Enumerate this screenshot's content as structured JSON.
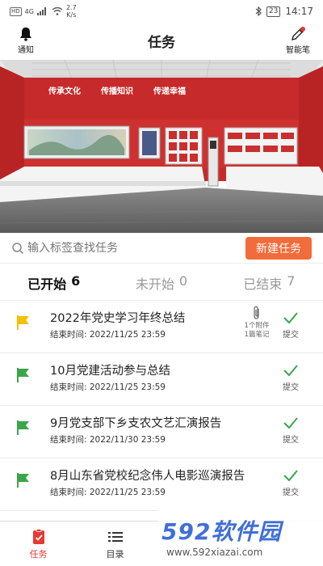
{
  "statusbar": {
    "hd": "HD",
    "signal": "4G",
    "speed_value": "2.7",
    "speed_unit": "K/s",
    "battery": "23",
    "time": "14:17"
  },
  "header": {
    "title": "任务",
    "notify_label": "通知",
    "smartpen_label": "智能笔"
  },
  "search": {
    "placeholder": "输入标签查找任务",
    "new_task_label": "新建任务"
  },
  "tabs": [
    {
      "label": "已开始",
      "count": "6"
    },
    {
      "label": "未开始",
      "count": "0"
    },
    {
      "label": "已结束",
      "count": "7"
    }
  ],
  "tasks": [
    {
      "title": "2022年党史学习年终总结",
      "due": "结束时间: 2022/11/25 23:59",
      "flag_color": "#f5c000",
      "attachments": "1个附件",
      "notes": "1篇笔记",
      "submit_label": "提交"
    },
    {
      "title": "10月党建活动参与总结",
      "due": "结束时间: 2022/11/25 23:59",
      "flag_color": "#3aa64a",
      "submit_label": "提交"
    },
    {
      "title": "9月党支部下乡支农文艺汇演报告",
      "due": "结束时间: 2022/11/30 23:59",
      "flag_color": "#3aa64a",
      "submit_label": "提交"
    },
    {
      "title": "8月山东省党校纪念伟人电影巡演报告",
      "due": "结束时间: 2022/11/25 23:59",
      "flag_color": "#3aa64a",
      "submit_label": "提交"
    }
  ],
  "banner": {
    "wall_text": [
      "传承文化",
      "传播知识",
      "传递幸福"
    ]
  },
  "bottomnav": {
    "task_label": "任务",
    "catalog_label": "目录"
  },
  "watermark": {
    "big": "592软件园",
    "small": "www.592xiazai.com"
  },
  "colors": {
    "accent": "#f26b3a",
    "nav_active": "#e53935",
    "check": "#3aa64a",
    "wall_red": "#c62a2a"
  },
  "icons": {
    "notify": "bell-icon",
    "smartpen": "pen-icon",
    "search": "search-icon",
    "attach": "paperclip-icon",
    "submit": "check-icon",
    "nav_task": "clipboard-check-icon",
    "nav_catalog": "list-icon"
  }
}
